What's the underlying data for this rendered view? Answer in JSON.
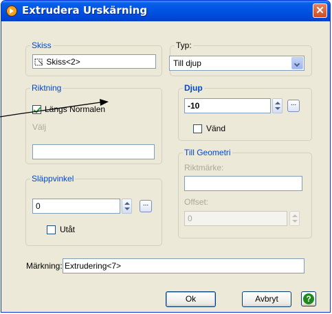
{
  "window": {
    "title": "Extrudera Urskärning",
    "close_glyph": "✕"
  },
  "sketch": {
    "legend": "Skiss",
    "value": "Skiss<2>"
  },
  "direction": {
    "legend": "Riktning",
    "normal_label": "Längs Normalen",
    "normal_checked": true,
    "select_label": "Välj",
    "select_value": ""
  },
  "draft": {
    "legend": "Släppvinkel",
    "value": "0",
    "outward_label": "Utåt",
    "outward_checked": false,
    "dots_label": "..."
  },
  "type": {
    "legend": "Typ:",
    "value": "Till djup"
  },
  "depth": {
    "legend": "Djup",
    "value": "-10",
    "dots_label": "...",
    "reverse_label": "Vänd",
    "reverse_checked": false
  },
  "to_geometry": {
    "legend": "Till Geometri",
    "target_label": "Riktmärke:",
    "target_value": "",
    "offset_label": "Offset:",
    "offset_value": "0"
  },
  "marking": {
    "label": "Märkning:",
    "value": "Extrudering<7>"
  },
  "buttons": {
    "ok": "Ok",
    "cancel": "Avbryt",
    "help_glyph": "?"
  },
  "icons": {
    "title": "app-logo-icon",
    "sketch": "sketch-icon",
    "help": "help-icon"
  }
}
